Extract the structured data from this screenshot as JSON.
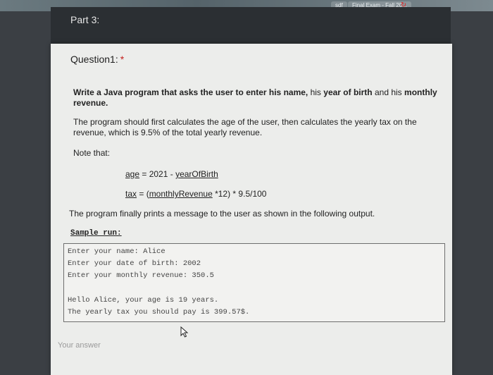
{
  "browser": {
    "tabs": [
      "sdf",
      "Final Exam - Fall 20..."
    ]
  },
  "form": {
    "part_title": "Part 3:",
    "question_title": "Question1:",
    "required_mark": "*",
    "instruction": {
      "bold_1": "Write a Java program that asks the user to enter his",
      "name": "name,",
      "mid": "his",
      "year": "year of birth",
      "and": "and his",
      "revenue": "monthly revenue."
    },
    "paragraph_2": "The program should first calculates the age of the user, then calculates the yearly tax on the revenue, which is 9.5% of the total yearly revenue.",
    "note": "Note that:",
    "formula_age": {
      "var": "age",
      "op": " = 2021 - ",
      "rhs": "yearOfBirth"
    },
    "formula_tax": {
      "var": "tax",
      "op": " = (",
      "rhs": "monthlyRevenue",
      "rest": " *12) * 9.5/100"
    },
    "paragraph_3": "The program finally prints a message to the user as shown in the following output.",
    "sample_label": "Sample run:",
    "sample_lines": {
      "l1": "Enter your name: Alice",
      "l2": "Enter your date of birth: 2002",
      "l3": "Enter your monthly revenue: 350.5",
      "l4": "Hello Alice, your age is 19 years.",
      "l5": "The yearly tax you should pay is 399.57$."
    },
    "answer_placeholder": "Your answer"
  }
}
